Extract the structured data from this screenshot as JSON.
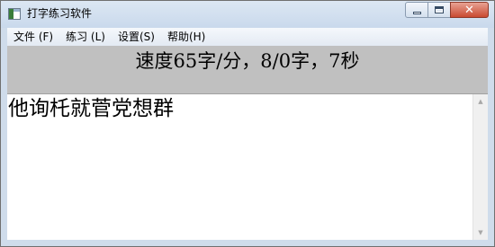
{
  "window": {
    "title": "打字练习软件"
  },
  "caption": {
    "minimize_icon": "minimize-icon",
    "maximize_icon": "maximize-icon",
    "close_icon": "close-icon",
    "close_glyph": "✕"
  },
  "menu": {
    "items": [
      {
        "label": "文件 (F)"
      },
      {
        "label": "练习 (L)"
      },
      {
        "label": "设置(S)"
      },
      {
        "label": "帮助(H)"
      }
    ]
  },
  "status": {
    "speed_text": "速度65字/分，8/0字，7秒"
  },
  "practice": {
    "text": "他询杔就菅党想群"
  },
  "scrollbar": {
    "up_glyph": "▲",
    "down_glyph": "▼"
  },
  "colors": {
    "status_panel_bg": "#c0c0c0",
    "close_button": "#c94a31"
  }
}
